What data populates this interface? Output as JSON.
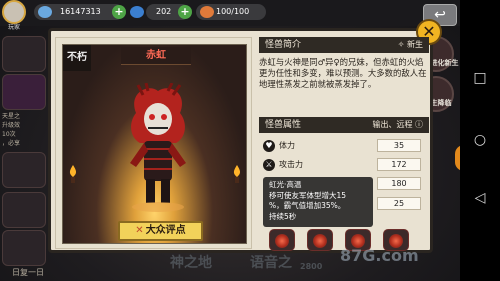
{
  "topbar": {
    "avatar_label": "玩家",
    "gold": "16147313",
    "gems": "202",
    "stamina": "100/100"
  },
  "left_side": {
    "text_lines": [
      "天星之",
      "升级效",
      "10次",
      "，必享"
    ],
    "bottom_label": "日复一日"
  },
  "right_side": {
    "buttons": [
      "怪物进化新生",
      "新生降临"
    ]
  },
  "ghost_texts": [
    "神之地",
    "语音之",
    "2800"
  ],
  "hero": {
    "name": "赤虹",
    "rank": "不朽",
    "review_label": "大众评点"
  },
  "intro": {
    "title": "怪兽简介",
    "tag": "新生",
    "description": "赤虹与火神是同♂异♀的兄妹，但赤虹的火焰更为任性和多变，难以预测。大多数的敌人在地理性蒸发之前就被蒸发掉了。"
  },
  "attributes": {
    "title": "怪兽属性",
    "roles": "输出、远程",
    "stats": [
      {
        "label": "体力",
        "value": "35"
      },
      {
        "label": "攻击力",
        "value": "172"
      },
      {
        "label": "",
        "value": "180"
      },
      {
        "label": "",
        "value": "25"
      }
    ]
  },
  "tooltip": {
    "title": "虹光·高温",
    "lines": [
      "移可使友军体型增大15",
      "%，霸气值增加35%。",
      "持续5秒"
    ]
  },
  "watermark": "87G.com",
  "close_label": "✕",
  "back_label": "↩"
}
